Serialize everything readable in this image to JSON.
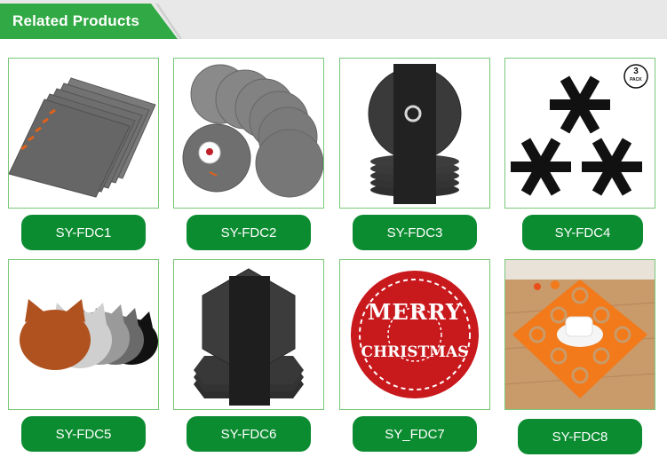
{
  "header": {
    "title": "Related Products"
  },
  "products": [
    {
      "code": "SY-FDC1"
    },
    {
      "code": "SY-FDC2"
    },
    {
      "code": "SY-FDC3"
    },
    {
      "code": "SY-FDC4",
      "badge_number": "3",
      "badge_text": "PACK"
    },
    {
      "code": "SY-FDC5"
    },
    {
      "code": "SY-FDC6"
    },
    {
      "code": "SY_FDC7",
      "image_text_1": "MERRY",
      "image_text_2": "CHRISTMAS"
    },
    {
      "code": "SY-FDC8"
    }
  ],
  "colors": {
    "brand_green": "#31a944",
    "button_green": "#0c8c31",
    "felt_grey": "#6b6b6b",
    "felt_dark": "#2b2b2b",
    "felt_red": "#c8191d",
    "felt_orange": "#f27a1a"
  }
}
